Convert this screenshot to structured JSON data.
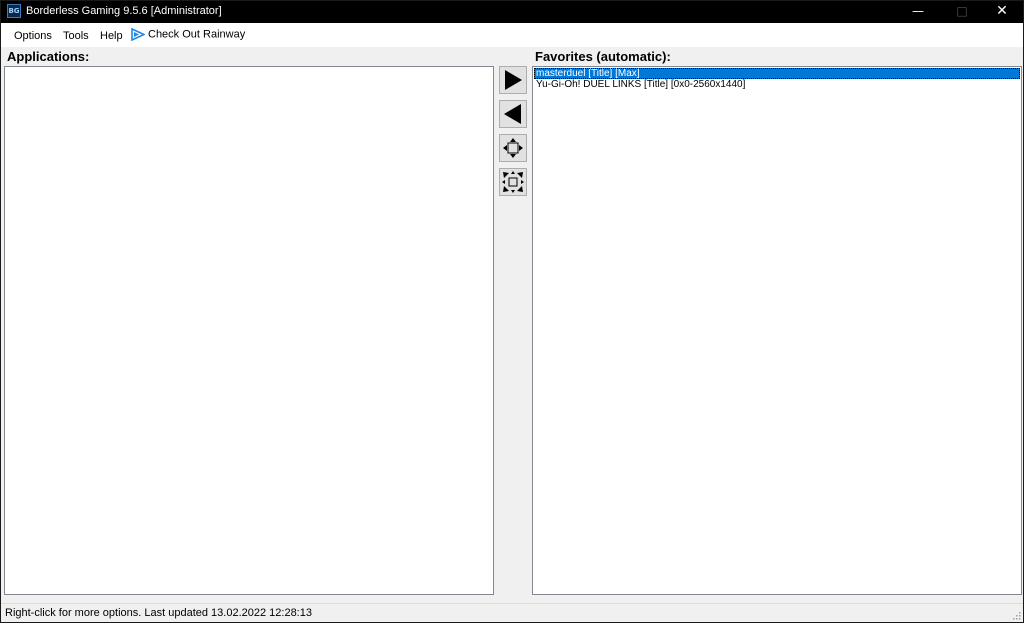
{
  "window": {
    "title": "Borderless Gaming 9.5.6 [Administrator]",
    "app_icon_text": "BG",
    "controls": {
      "minimize": "—",
      "maximize": "□",
      "close": "✕"
    }
  },
  "menu": {
    "options": "Options",
    "tools": "Tools",
    "help": "Help",
    "rainway": "Check Out Rainway",
    "rainway_icon": "rainway-logo-icon"
  },
  "applications": {
    "label": "Applications:",
    "items": []
  },
  "favorites": {
    "label": "Favorites (automatic):",
    "items": [
      {
        "text": "masterduel [Title] [Max]",
        "selected": true
      },
      {
        "text": "Yu-Gi-Oh! DUEL LINKS [Title] [0x0-2560x1440]",
        "selected": false
      }
    ]
  },
  "buttons": {
    "add": "arrow-right-icon",
    "remove": "arrow-left-icon",
    "make_borderless": "window-arrows-inward-icon",
    "restore": "window-arrows-outward-icon"
  },
  "status": {
    "text": "Right-click for more options. Last updated 13.02.2022 12:28:13"
  },
  "colors": {
    "titlebar": "#000000",
    "selection": "#0078d7",
    "rainway_accent": "#1e88e5"
  }
}
